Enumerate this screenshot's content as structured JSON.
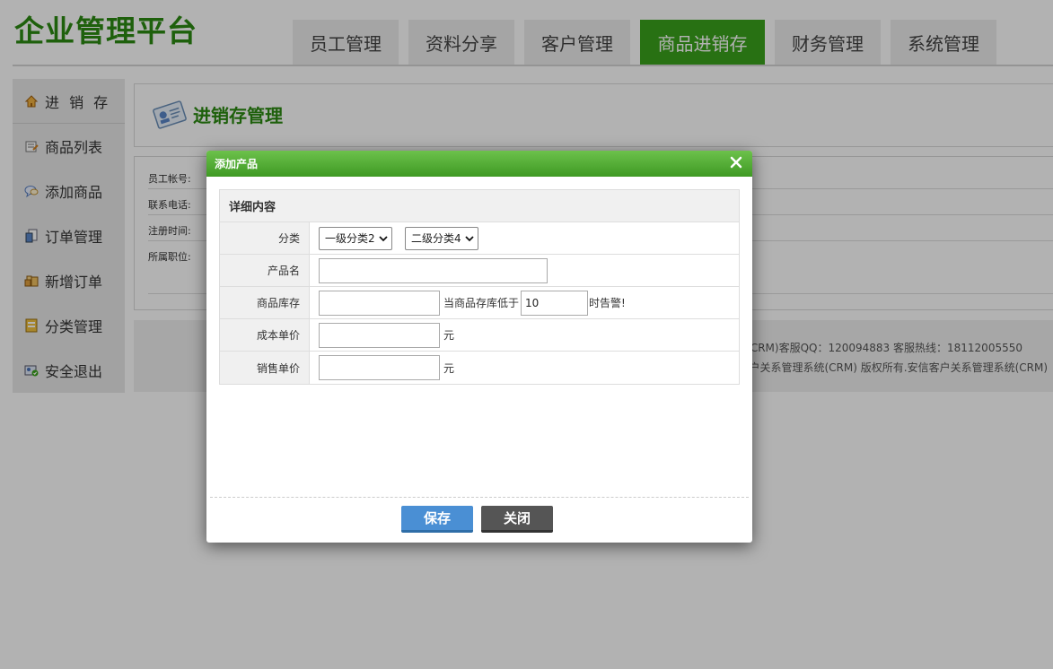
{
  "header": {
    "logo": "企业管理平台",
    "tabs": [
      {
        "label": "员工管理"
      },
      {
        "label": "资料分享"
      },
      {
        "label": "客户管理"
      },
      {
        "label": "商品进销存",
        "active": true
      },
      {
        "label": "财务管理"
      },
      {
        "label": "系统管理"
      }
    ]
  },
  "sidebar": {
    "items": [
      {
        "label": "进 销 存",
        "icon": "home-icon"
      },
      {
        "label": "商品列表",
        "icon": "list-icon"
      },
      {
        "label": "添加商品",
        "icon": "chat-icon"
      },
      {
        "label": "订单管理",
        "icon": "document-icon"
      },
      {
        "label": "新增订单",
        "icon": "box-icon"
      },
      {
        "label": "分类管理",
        "icon": "folder-icon"
      },
      {
        "label": "安全退出",
        "icon": "exit-icon"
      }
    ]
  },
  "main": {
    "title": "进销存管理",
    "info": {
      "account": "员工帐号:",
      "phone": "联系电话:",
      "reg_time": "注册时间:",
      "position": "所属职位:"
    },
    "footer": {
      "line1": "统(CRM)客服QQ：120094883 客服热线：18112005550",
      "line2": "户关系管理系统(CRM) 版权所有.安信客户关系管理系统(CRM)"
    }
  },
  "dialog": {
    "title": "添加产品",
    "section_title": "详细内容",
    "fields": {
      "category_label": "分类",
      "category1_value": "一级分类2",
      "category2_value": "二级分类4",
      "name_label": "产品名",
      "name_value": "",
      "stock_label": "商品库存",
      "stock_value": "",
      "alert_prefix": "当商品存库低于",
      "alert_value": "10",
      "alert_suffix": "时告警!",
      "cost_label": "成本单价",
      "cost_value": "",
      "cost_unit": "元",
      "sale_label": "销售单价",
      "sale_value": "",
      "sale_unit": "元"
    },
    "save_label": "保存",
    "close_label": "关闭"
  },
  "colors": {
    "brand_green": "#3aa31c",
    "save_blue": "#4a8fd4",
    "close_gray": "#555555"
  }
}
